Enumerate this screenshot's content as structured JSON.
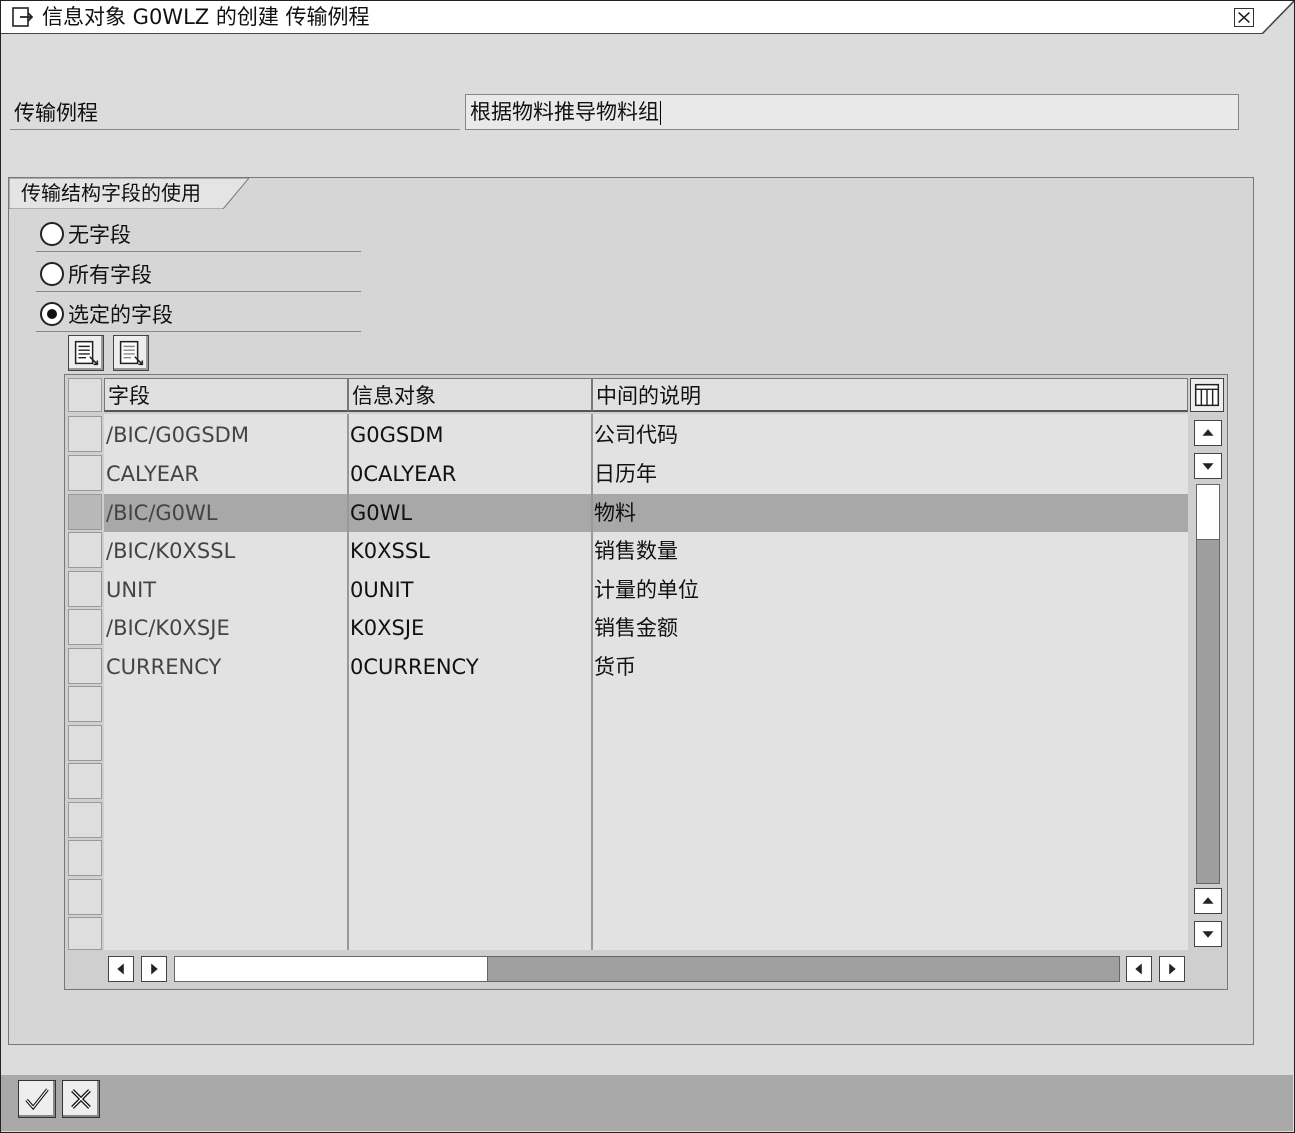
{
  "window": {
    "title": "信息对象 G0WLZ 的创建 传输例程"
  },
  "routine": {
    "label": "传输例程",
    "value": "根据物料推导物料组"
  },
  "group": {
    "title": "传输结构字段的使用"
  },
  "options": [
    {
      "label": "无字段",
      "selected": false
    },
    {
      "label": "所有字段",
      "selected": false
    },
    {
      "label": "选定的字段",
      "selected": true
    }
  ],
  "table": {
    "columns": [
      "字段",
      "信息对象",
      "中间的说明"
    ],
    "rows": [
      {
        "field": "/BIC/G0GSDM",
        "infoobject": "G0GSDM",
        "description": "公司代码"
      },
      {
        "field": "CALYEAR",
        "infoobject": "0CALYEAR",
        "description": "日历年"
      },
      {
        "field": "/BIC/G0WL",
        "infoobject": "G0WL",
        "description": "物料",
        "highlighted": true
      },
      {
        "field": "/BIC/K0XSSL",
        "infoobject": "K0XSSL",
        "description": "销售数量"
      },
      {
        "field": "UNIT",
        "infoobject": "0UNIT",
        "description": "计量的单位"
      },
      {
        "field": "/BIC/K0XSJE",
        "infoobject": "K0XSJE",
        "description": "销售金额"
      },
      {
        "field": "CURRENCY",
        "infoobject": "0CURRENCY",
        "description": "货币"
      }
    ]
  },
  "icons": {
    "title": "dialog-icon",
    "close": "close-icon",
    "select_all": "select-all-icon",
    "deselect_all": "deselect-all-icon",
    "column_config": "column-config-icon",
    "confirm": "check-icon",
    "cancel": "cross-icon"
  }
}
